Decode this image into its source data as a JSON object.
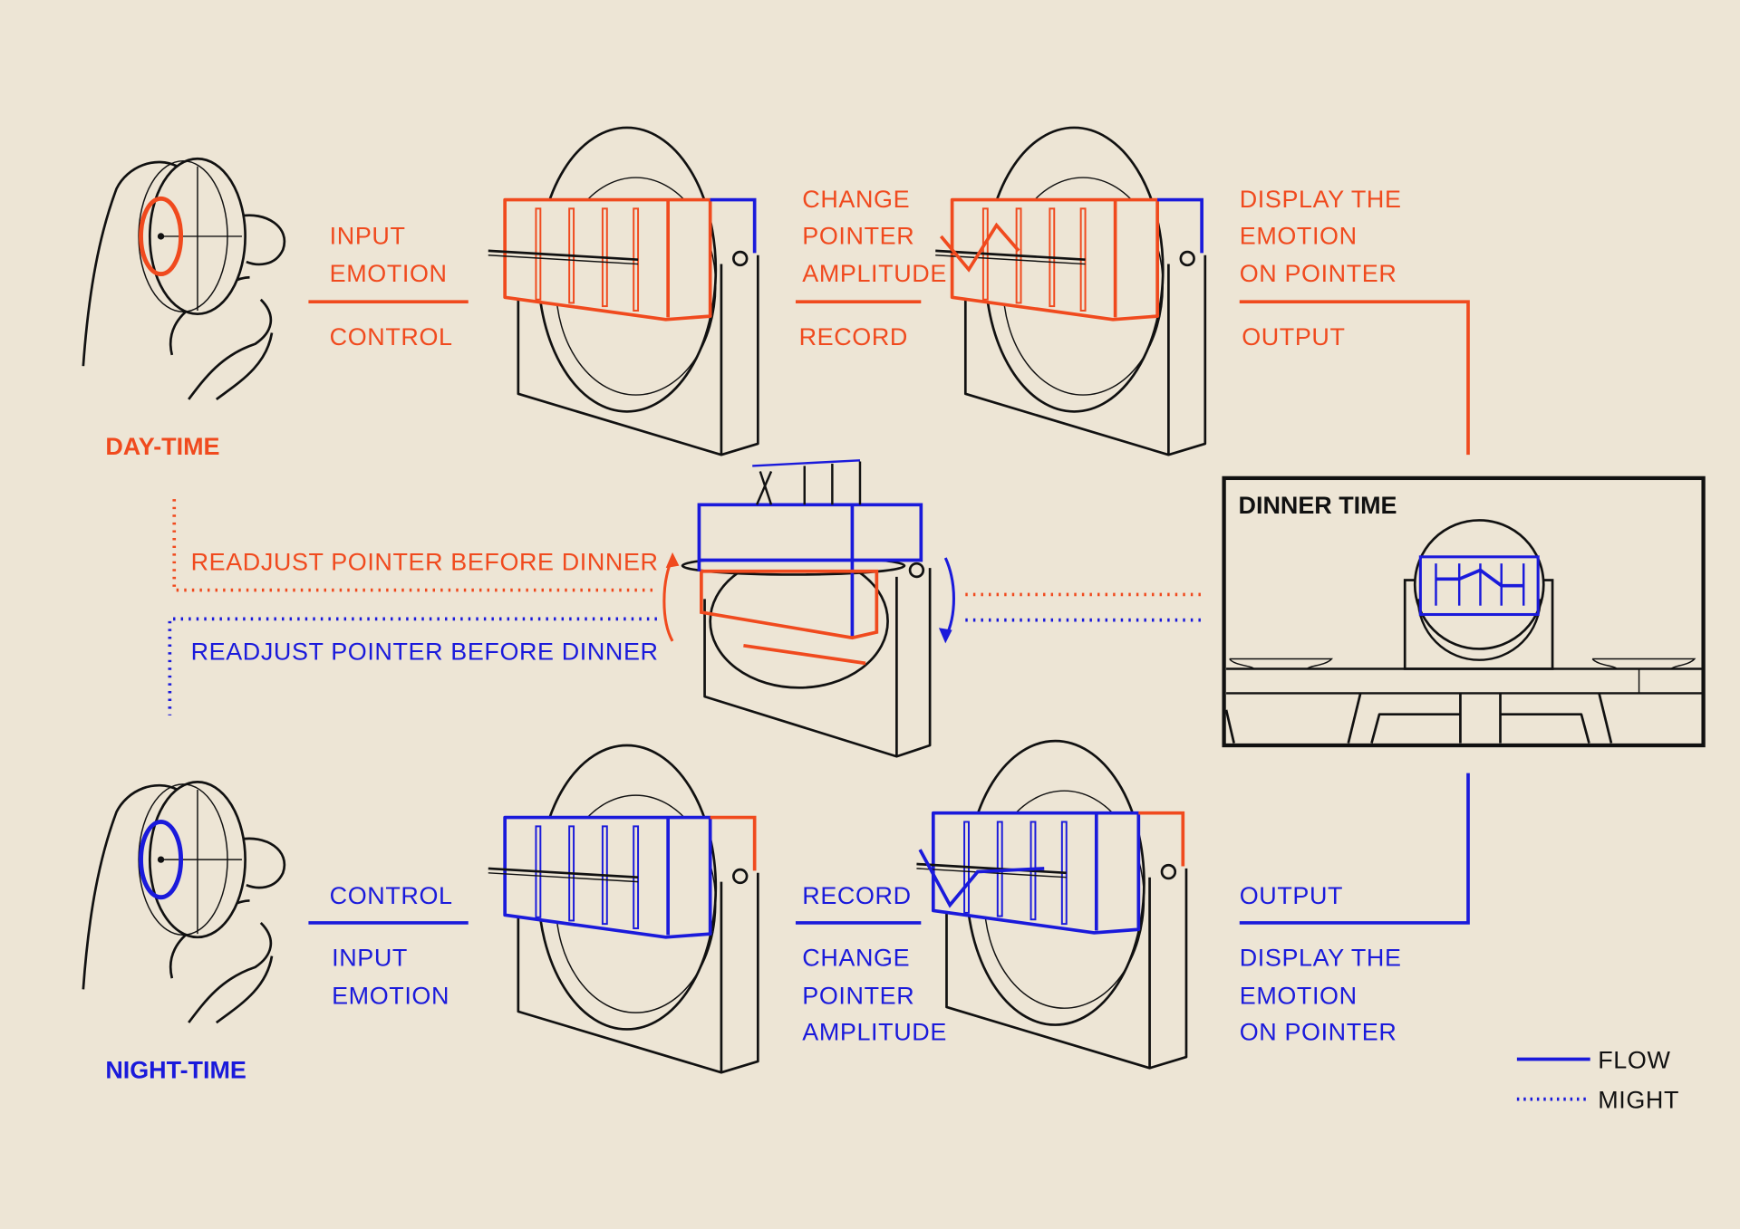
{
  "colors": {
    "background": "#ede5d5",
    "day": "#f04a1e",
    "night": "#1a1adb",
    "ink": "#111111"
  },
  "day": {
    "title": "DAY-TIME",
    "step1": {
      "top": [
        "INPUT",
        "EMOTION"
      ],
      "bottom": "CONTROL"
    },
    "step2": {
      "top": [
        "CHANGE",
        "POINTER",
        "AMPLITUDE"
      ],
      "bottom": "RECORD"
    },
    "step3": {
      "top": [
        "DISPLAY THE",
        "EMOTION",
        "ON POINTER"
      ],
      "bottom": "OUTPUT"
    },
    "readjust": "READJUST POINTER BEFORE DINNER"
  },
  "night": {
    "title": "NIGHT-TIME",
    "step1": {
      "top": "CONTROL",
      "bottom": [
        "INPUT",
        "EMOTION"
      ]
    },
    "step2": {
      "top": "RECORD",
      "bottom": [
        "CHANGE",
        "POINTER",
        "AMPLITUDE"
      ]
    },
    "step3": {
      "top": "OUTPUT",
      "bottom": [
        "DISPLAY THE",
        "EMOTION",
        "ON POINTER"
      ]
    },
    "readjust": "READJUST POINTER BEFORE DINNER"
  },
  "dinner": {
    "title": "DINNER TIME"
  },
  "legend": {
    "flow": "FLOW",
    "might": "MIGHT"
  }
}
